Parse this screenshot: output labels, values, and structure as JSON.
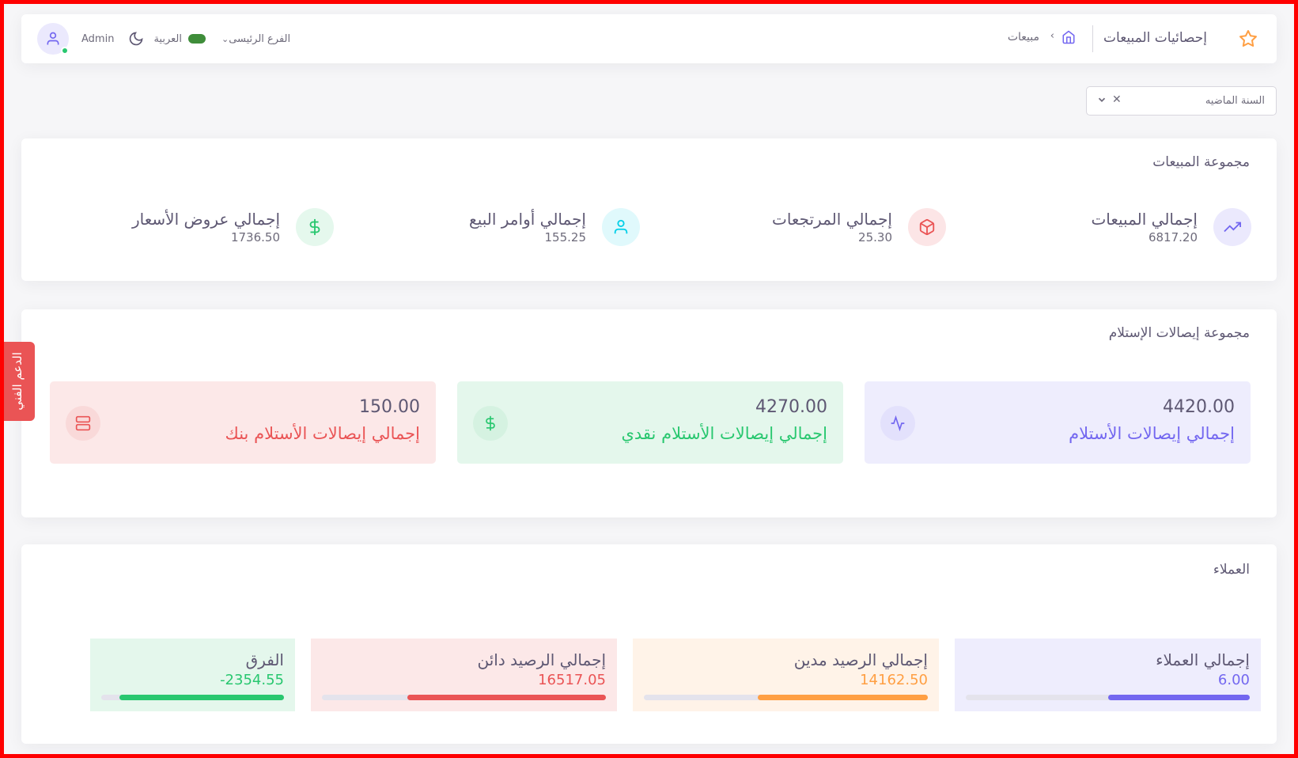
{
  "navbar": {
    "title": "إحصائيات المبيعات",
    "breadcrumb": "مبيعات",
    "branch": "الفرع الرئيسى",
    "language": "العربية",
    "user": "Admin"
  },
  "filter": {
    "value": "السنة الماضيه"
  },
  "sales": {
    "title": "مجموعة المبيعات",
    "items": [
      {
        "label": "إجمالي المبيعات",
        "value": "6817.20",
        "icon": "trending-up-icon",
        "color": "#7367f0",
        "bg": "#ebe9fd"
      },
      {
        "label": "إجمالي المرتجعات",
        "value": "25.30",
        "icon": "box-icon",
        "color": "#ea5455",
        "bg": "#fce5e6"
      },
      {
        "label": "إجمالي أوامر البيع",
        "value": "155.25",
        "icon": "user-icon",
        "color": "#00cfe8",
        "bg": "#e0f9fc"
      },
      {
        "label": "إجمالي عروض الأسعار",
        "value": "1736.50",
        "icon": "dollar-icon",
        "color": "#28c76f",
        "bg": "#e5f8ed"
      }
    ]
  },
  "receipts": {
    "title": "مجموعة إيصالات الإستلام",
    "items": [
      {
        "label": "إجمالي إيصالات الأستلام",
        "value": "4420.00",
        "icon": "activity-icon",
        "color": "#7367f0",
        "bg": "#eeedfd",
        "iconBg": "#e3e1fc"
      },
      {
        "label": "إجمالي إيصالات الأستلام نقدي",
        "value": "4270.00",
        "icon": "dollar-icon",
        "color": "#28c76f",
        "bg": "#e4f7ec",
        "iconBg": "#d5f2e1"
      },
      {
        "label": "إجمالي إيصالات الأستلام بنك",
        "value": "150.00",
        "icon": "server-icon",
        "color": "#ea5455",
        "bg": "#fce8e8",
        "iconBg": "#f9d9d9"
      }
    ]
  },
  "support": {
    "label": "الدعم الفني"
  },
  "customers": {
    "title": "العملاء",
    "items": [
      {
        "label": "إجمالي العملاء",
        "value": "6.00",
        "color": "#7367f0",
        "bg": "#eeedfd",
        "progress": 0.5
      },
      {
        "label": "إجمالي الرصيد مدين",
        "value": "14162.50",
        "color": "#ff9f43",
        "bg": "#fff3e8",
        "progress": 0.6
      },
      {
        "label": "إجمالي الرصيد دائن",
        "value": "16517.05",
        "color": "#ea5455",
        "bg": "#fce8e8",
        "progress": 0.7
      },
      {
        "label": "الفرق",
        "value": "-2354.55",
        "color": "#28c76f",
        "bg": "#e4f7ec",
        "progress": 0.9
      }
    ]
  }
}
